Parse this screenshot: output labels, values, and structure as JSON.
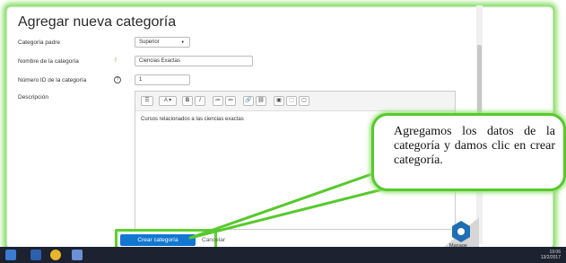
{
  "page": {
    "title": "Agregar nueva categoría"
  },
  "form": {
    "parent_label": "Categoría padre",
    "parent_value": "Superior",
    "name_label": "Nombre de la categoría",
    "name_value": "Ciencias Exactas",
    "id_label": "Número ID de la categoría",
    "id_value": "1",
    "description_label": "Descripción",
    "description_value": "Cursos relacionados a las ciencias exactas",
    "required_mark": "!",
    "help_mark": "?"
  },
  "toolbar": {
    "items": [
      "☰",
      "A ▾",
      "B",
      "I",
      "≔",
      "≕",
      "🔗",
      "⛓",
      "▣",
      "⬚",
      "▢"
    ]
  },
  "buttons": {
    "create_label": "Crear categoría",
    "cancel_label": "Cancelar"
  },
  "callout": {
    "text": "Agregamos los datos de la categoría y damos clic en crear categoría."
  },
  "branding": {
    "manage_label": "Manage"
  },
  "system_tray": {
    "time": "19:06",
    "date": "13/2/2017"
  },
  "colors": {
    "highlight_green": "#5cd12e",
    "primary_button": "#1177d1",
    "taskbar": "#1c2230"
  }
}
